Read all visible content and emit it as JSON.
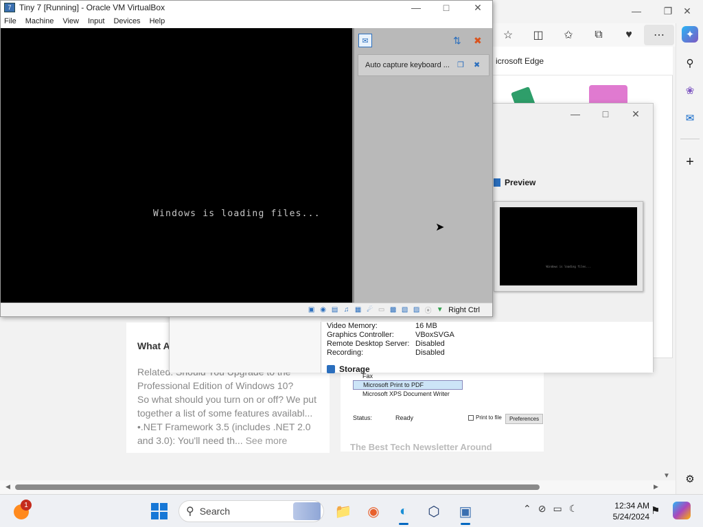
{
  "vm": {
    "title": "Tiny 7 [Running] - Oracle VM VirtualBox",
    "menu": [
      "File",
      "Machine",
      "View",
      "Input",
      "Devices",
      "Help"
    ],
    "boot_text": "Windows is loading files...",
    "notification": "Auto capture keyboard ...",
    "host_key": "Right Ctrl"
  },
  "edge": {
    "tab_title": "icrosoft Edge"
  },
  "settings": {
    "preview_label": "Preview",
    "preview_text": "Windows is loading files...",
    "details": [
      {
        "k": "Video Memory:",
        "v": "16 MB"
      },
      {
        "k": "Graphics Controller:",
        "v": "VBoxSVGA"
      },
      {
        "k": "Remote Desktop Server:",
        "v": "Disabled"
      },
      {
        "k": "Recording:",
        "v": "Disabled"
      }
    ],
    "storage_label": "Storage"
  },
  "article": {
    "heading": "What A",
    "lines": [
      "Related: Should You Upgrade to the",
      "Professional Edition of Windows 10?",
      "So what should you turn on or off? We put",
      "together a list of some features availabl...",
      "•.NET Framework 3.5 (includes .NET 2.0",
      "and 3.0): You'll need th..."
    ],
    "see_more": "See more"
  },
  "print_dialog": {
    "printers": [
      "Fax",
      "Microsoft Print to PDF",
      "Microsoft XPS Document Writer"
    ],
    "status_label": "Status:",
    "status_value": "Ready",
    "print_to_file": "Print to file",
    "preferences": "Preferences",
    "newsletter": "The Best Tech Newsletter Around"
  },
  "taskbar": {
    "weather_badge": "1",
    "search_placeholder": "Search",
    "time": "12:34 AM",
    "date": "5/24/2024"
  },
  "colors": {
    "accent": "#0067c0",
    "vm_screen": "#000000",
    "notify_pane": "#b9b9b9"
  }
}
